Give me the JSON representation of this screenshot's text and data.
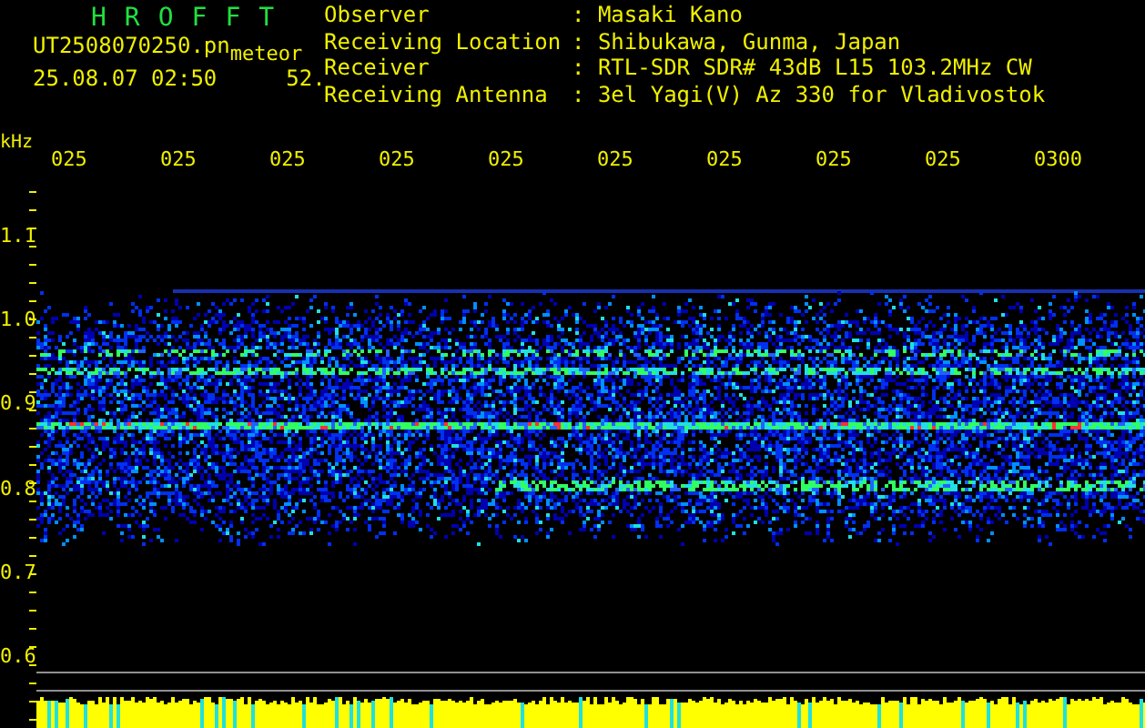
{
  "header": {
    "title": "HROFFT",
    "file": "UT2508070250.pn",
    "tag": "meteor",
    "datetime": "25.08.07 02:50",
    "value": "52."
  },
  "info": [
    {
      "label": "Observer",
      "value": ": Masaki Kano"
    },
    {
      "label": "Receiving Location",
      "value": ": Shibukawa, Gunma, Japan"
    },
    {
      "label": "Receiver",
      "value": ": RTL-SDR SDR# 43dB L15 103.2MHz CW"
    },
    {
      "label": "Receiving Antenna",
      "value": ": 3el Yagi(V) Az 330 for Vladivostok"
    }
  ],
  "axis": {
    "unit": "kHz",
    "time_labels": [
      "025",
      "025",
      "025",
      "025",
      "025",
      "025",
      "025",
      "025",
      "025",
      "0300"
    ],
    "freq_labels": [
      "1.1",
      "1.0",
      "0.9",
      "0.8",
      "0.7",
      "0.6"
    ]
  }
}
